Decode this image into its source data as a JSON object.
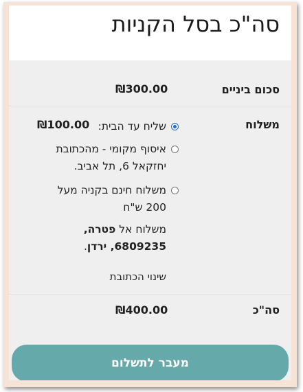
{
  "cart": {
    "title": "סה\"כ בסל הקניות",
    "subtotal_label": "סכום ביניים",
    "subtotal_value": "₪300.00",
    "shipping_label": "משלוח",
    "shipping_options": [
      {
        "label": "שליח עד הבית:",
        "price": "₪100.00",
        "selected": true
      },
      {
        "line1": "איסוף מקומי - מהכתובת",
        "line2": "יחזקאל 6, תל אביב.",
        "selected": false
      },
      {
        "line1": "משלוח חינם בקניה מעל",
        "line2": "200 ש\"ח",
        "selected": false
      }
    ],
    "ship_to": {
      "prefix": "משלוח אל",
      "city": "פטרה,",
      "zip_country": "6809235, ירדן",
      "end": "."
    },
    "change_address": "שינוי הכתובת",
    "total_label": "סה\"כ",
    "total_value": "₪400.00",
    "checkout_button": "מעבר לתשלום"
  },
  "colors": {
    "checkout_bg": "#66a9ab",
    "radio_selected": "#1f6ad6",
    "frame_bg": "#f6e3d6"
  }
}
